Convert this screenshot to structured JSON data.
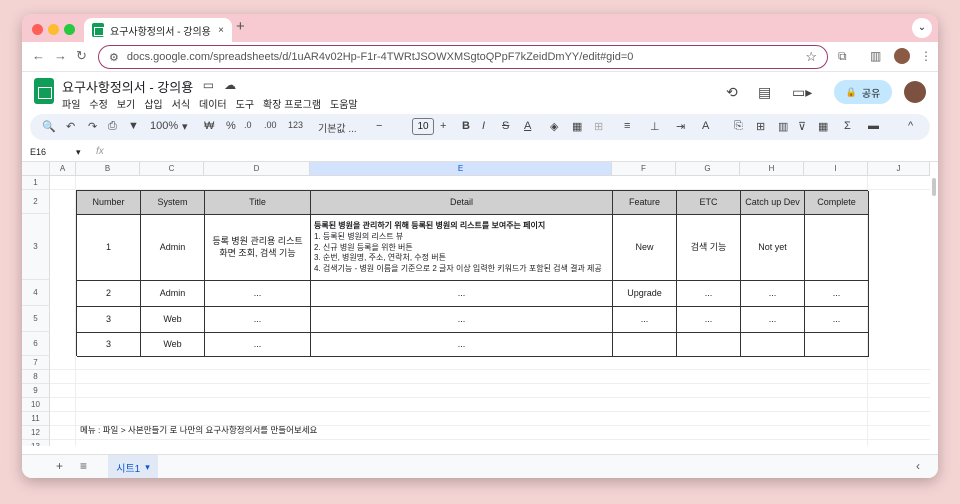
{
  "browser": {
    "tab_title": "요구사항정의서 - 강의용 - Google Sheets",
    "tab_close": "×",
    "new_tab": "+",
    "tab_menu": "⌄",
    "url": "docs.google.com/spreadsheets/d/1uAR4v02Hp-F1r-4TWRtJSOWXMSgtoQPpF7kZeidDmYY/edit#gid=0",
    "back": "←",
    "forward": "→",
    "reload": "↻",
    "site_info": "⚙",
    "bookmark": "☆",
    "extensions": "⧉",
    "sidepanel": "▥",
    "menu": "⋮"
  },
  "doc": {
    "title": "요구사항정의서 - 강의용",
    "star": "☆",
    "move": "▭",
    "cloud": "☁",
    "menu": [
      "파일",
      "수정",
      "보기",
      "삽입",
      "서식",
      "데이터",
      "도구",
      "확장 프로그램",
      "도움말"
    ],
    "history": "⟲",
    "comment": "▤",
    "meet": "▭▸",
    "share_label": "공유",
    "share_icon": "🔒"
  },
  "toolbar": {
    "search": "🔍",
    "undo": "↶",
    "redo": "↷",
    "print": "⎙",
    "paint": "▼",
    "zoom": "100%",
    "currency": "₩",
    "percent": "%",
    "dec_decrease": ".0",
    "dec_increase": ".00",
    "format_123": "123",
    "font": "기본값 ...",
    "minus": "−",
    "font_size": "10",
    "plus": "+",
    "bold": "B",
    "italic": "I",
    "strike": "S",
    "text_color": "A",
    "fill": "◈",
    "borders": "▦",
    "merge": "⊞",
    "align": "≡",
    "valign": "⊥",
    "wrap": "⇥",
    "rotate": "A",
    "link": "⎘",
    "comment_add": "⊞",
    "chart": "▥",
    "filter": "⊽",
    "filter_views": "▦",
    "functions": "Σ",
    "input_tools": "▬",
    "collapse": "^"
  },
  "formula_bar": {
    "name_box": "E16",
    "fx": "fx",
    "dropdown": "▾"
  },
  "grid": {
    "columns": [
      "A",
      "B",
      "C",
      "D",
      "E",
      "F",
      "G",
      "H",
      "I",
      "J"
    ],
    "rows": [
      "1",
      "2",
      "3",
      "4",
      "5",
      "6",
      "7",
      "8",
      "9",
      "10",
      "11",
      "12",
      "13"
    ],
    "table": {
      "headers": [
        "Number",
        "System",
        "Title",
        "Detail",
        "Feature",
        "ETC",
        "Catch up Dev",
        "Complete"
      ],
      "row1": {
        "number": "1",
        "system": "Admin",
        "title": "등록 병원 관리용 리스트 화면 조회, 검색 기능",
        "detail_bold": "등록된 병원을 관리하기 위해 등록된 병원의 리스트를 보여주는 페이지",
        "detail_lines": [
          "1. 등록된 병원의 리스트 뷰",
          "2. 신규 병원 등록을 위한 버튼",
          "3. 순번, 병원명, 주소, 연락처, 수정 버튼",
          "4. 검색기능 - 병원 이름을 기준으로 2 글자 이상 입력한 키워드가 포함된 검색 결과 제공"
        ],
        "feature": "New",
        "etc": "검색 기능",
        "catchup": "Not yet",
        "complete": ""
      },
      "row2": {
        "number": "2",
        "system": "Admin",
        "title": "...",
        "detail": "...",
        "feature": "Upgrade",
        "etc": "...",
        "catchup": "...",
        "complete": "..."
      },
      "row3": {
        "number": "3",
        "system": "Web",
        "title": "...",
        "detail": "...",
        "feature": "...",
        "etc": "...",
        "catchup": "...",
        "complete": "..."
      },
      "row4": {
        "number": "3",
        "system": "Web",
        "title": "...",
        "detail": "...",
        "feature": "",
        "etc": "",
        "catchup": "",
        "complete": ""
      }
    },
    "note": "메뉴 : 파일 > 사본만들기 로 나만의 요구사항정의서를 만들어보세요"
  },
  "sheets": {
    "add": "+",
    "all": "≡",
    "tab_name": "시트1",
    "tab_menu": "▾",
    "nav": "‹"
  },
  "colors": {
    "header_fill": "#d0d0d0",
    "sheets_green": "#0f9d58",
    "share_bg": "#c2e7ff",
    "selected": "#0b57d0"
  }
}
